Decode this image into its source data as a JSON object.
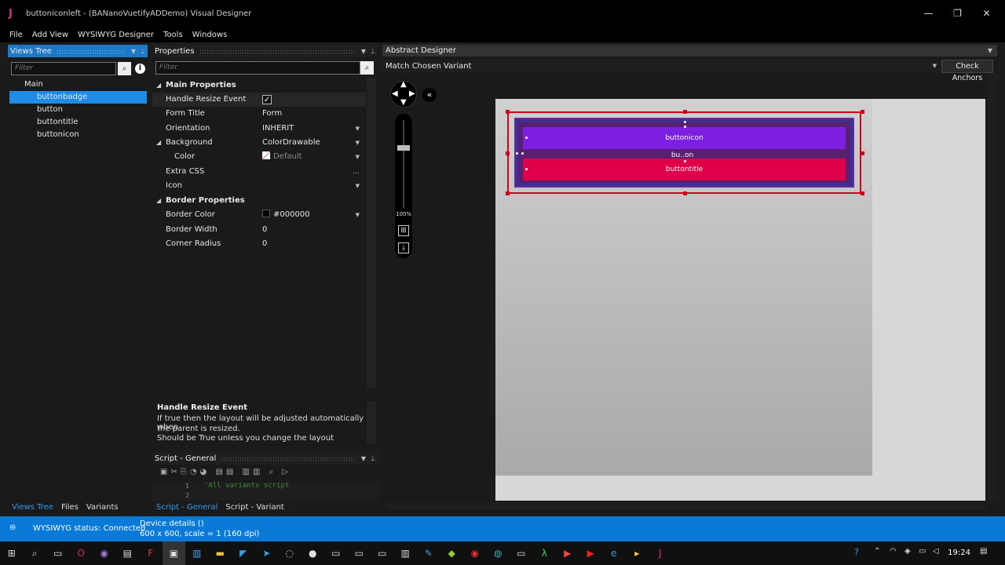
{
  "window": {
    "app_icon": "J",
    "title": "buttoniconleft - (BANanoVuetifyADDemo) Visual Designer",
    "minimize": "—",
    "maximize": "❐",
    "close": "✕"
  },
  "menu": [
    "File",
    "Add View",
    "WYSIWYG Designer",
    "Tools",
    "Windows"
  ],
  "views_tree": {
    "title": "Views Tree",
    "filter_placeholder": "Filter",
    "items": [
      "Main",
      "buttonbadge",
      "button",
      "buttontitle",
      "buttonicon"
    ],
    "selected": "buttonbadge",
    "bottom_tabs": [
      "Views Tree",
      "Files",
      "Variants"
    ]
  },
  "properties": {
    "title": "Properties",
    "filter_placeholder": "Filter",
    "sections": {
      "main": "Main Properties",
      "background": "Background",
      "border": "Border Properties"
    },
    "rows": {
      "handle_resize": {
        "name": "Handle Resize Event",
        "checked": "✓"
      },
      "form_title": {
        "name": "Form Title",
        "value": "Form"
      },
      "orientation": {
        "name": "Orientation",
        "value": "INHERIT"
      },
      "background": {
        "value": "ColorDrawable"
      },
      "color": {
        "name": "Color",
        "value": "Default"
      },
      "extra_css": {
        "name": "Extra CSS",
        "value": "..."
      },
      "icon": {
        "name": "Icon",
        "value": ""
      },
      "border_color": {
        "name": "Border Color",
        "value": "#000000"
      },
      "border_width": {
        "name": "Border Width",
        "value": "0"
      },
      "corner_radius": {
        "name": "Corner Radius",
        "value": "0"
      }
    },
    "description": {
      "title": "Handle Resize Event",
      "line1": "If true then the layout will be adjusted automatically when",
      "line2": "the parent is resized.",
      "line3": "Should be True unless you change the layout"
    }
  },
  "script": {
    "title": "Script - General",
    "line_no_1": "1",
    "line_no_2": "2",
    "code": "'All variants script",
    "bottom_tabs": [
      "Script - General",
      "Script - Variant"
    ]
  },
  "designer": {
    "title": "Abstract Designer",
    "variant": "Match Chosen Variant",
    "check_anchors": "Check Anchors",
    "zoom": "100%",
    "collapse": "«",
    "buttons": {
      "icon": "buttonicon",
      "button": "bu..on",
      "title": "buttontitle"
    }
  },
  "status": {
    "text": "WYSIWYG status: Connected",
    "device_title": "Device details ()",
    "device_info": "600 x 600, scale = 1 (160 dpi)"
  },
  "taskbar": {
    "clock": "19:24"
  },
  "colors": {
    "accent": "#1e8be6",
    "status_bar": "#0a7ad8",
    "button_icon": "#7c1fe0",
    "button_title": "#e0004a",
    "selection": "#d0021b"
  }
}
